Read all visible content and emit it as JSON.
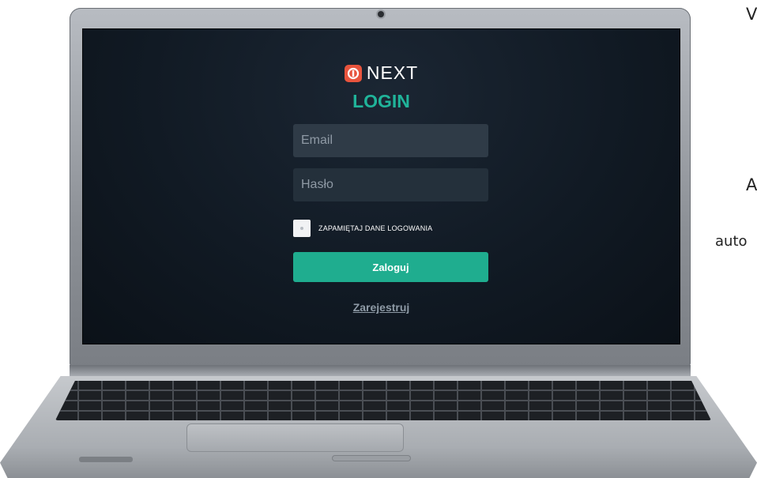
{
  "login_form": {
    "brand_name": "NEXT",
    "title": "LOGIN",
    "email_placeholder": "Email",
    "password_placeholder": "Hasło",
    "remember_label": "ZAPAMIĘTAJ DANE LOGOWANIA",
    "login_button": "Zaloguj",
    "register_link": "Zarejestruj"
  },
  "side_text": {
    "line1": "V",
    "line2": "A",
    "line3": "auto"
  },
  "colors": {
    "accent": "#1fad8f",
    "title": "#20b49a",
    "logo": "#e8543d",
    "screen_bg": "#111a24"
  },
  "icons": {
    "logo": "next-logo-icon",
    "checkbox": "checkbox-icon"
  }
}
